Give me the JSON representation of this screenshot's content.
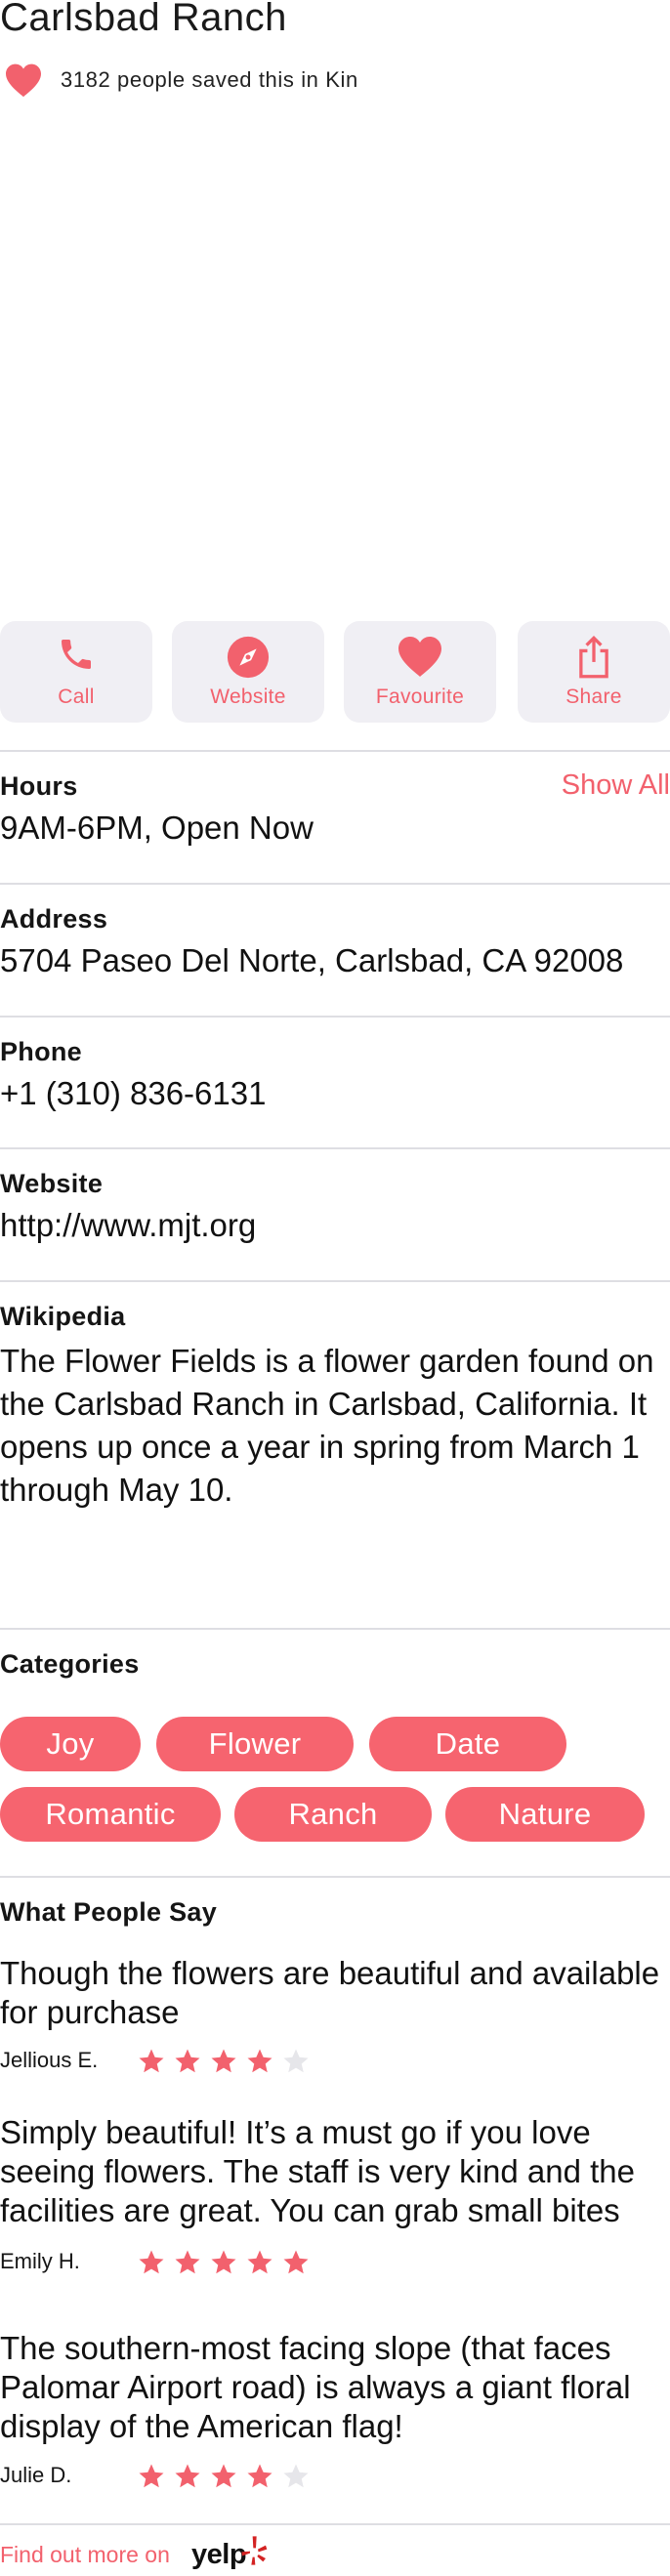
{
  "place": {
    "title": "Carlsbad Ranch",
    "saves_text": "3182 people saved this in Kin",
    "heart_icon": "heart-icon",
    "accent_color": "#f2616d"
  },
  "actions": [
    {
      "label": "Call",
      "icon": "phone-icon"
    },
    {
      "label": "Website",
      "icon": "compass-icon"
    },
    {
      "label": "Favourite",
      "icon": "heart-icon"
    },
    {
      "label": "Share",
      "icon": "share-icon"
    }
  ],
  "hours": {
    "label": "Hours",
    "value": "9AM-6PM, Open Now",
    "show_all": "Show All"
  },
  "address": {
    "label": "Address",
    "value": "5704 Paseo Del Norte, Carlsbad, CA 92008"
  },
  "phone": {
    "label": "Phone",
    "value": "+1 (310) 836-6131"
  },
  "website": {
    "label": "Website",
    "value": "http://www.mjt.org"
  },
  "wikipedia": {
    "label": "Wikipedia",
    "text": "The Flower Fields is a flower garden found on the Carlsbad Ranch in Carlsbad, California. It opens up once a year in spring from March 1 through May 10."
  },
  "categories": {
    "label": "Categories",
    "chips": [
      "Joy",
      "Flower",
      "Date",
      "Romantic",
      "Ranch",
      "Nature"
    ]
  },
  "reviews": {
    "label": "What People Say",
    "items": [
      {
        "text": "Though the flowers are beautiful and available for purchase",
        "author": "Jellious E.",
        "rating": 4
      },
      {
        "text": "Simply beautiful! It’s a must go if you love seeing flowers. The staff is very kind and the facilities are great. You can grab small bites",
        "author": "Emily H.",
        "rating": 5
      },
      {
        "text": "The southern-most facing slope (that faces Palomar Airport road) is always a giant floral display of the American flag!",
        "author": "Julie D.",
        "rating": 4
      }
    ],
    "star_color_filled": "#f2616d",
    "star_color_empty": "#e6e6ea"
  },
  "footer": {
    "link_text": "Find out more on",
    "brand": "yelp"
  }
}
